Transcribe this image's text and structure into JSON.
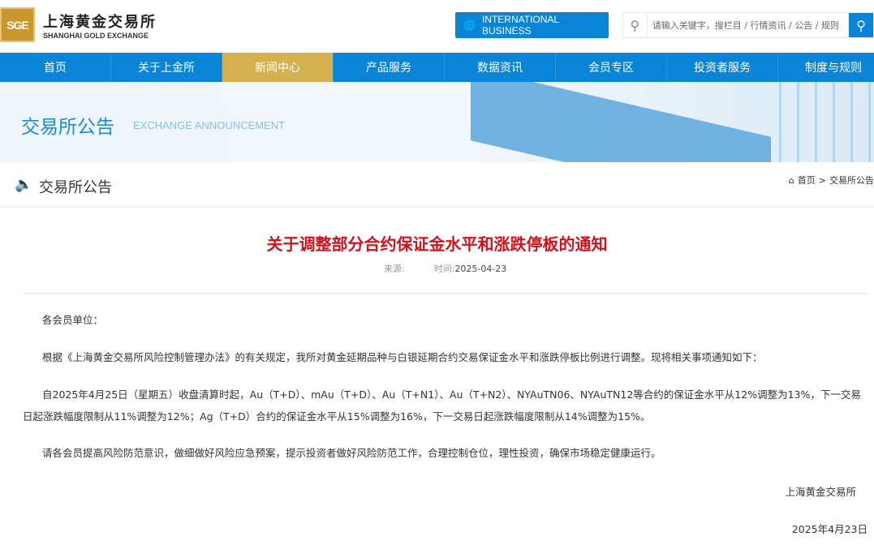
{
  "header": {
    "logo_mark": "SGE",
    "logo_cn": "上海黄金交易所",
    "logo_en": "SHANGHAI GOLD EXCHANGE",
    "intl_button": "INTERNATIONAL BUSINESS",
    "search_placeholder": "请输入关键字，搜栏目 / 行情资讯 / 公告 / 规则"
  },
  "nav": [
    "首页",
    "关于上金所",
    "新闻中心",
    "产品服务",
    "数据资讯",
    "会员专区",
    "投资者服务",
    "制度与规则"
  ],
  "banner": {
    "title_cn": "交易所公告",
    "title_en": "EXCHANGE ANNOUNCEMENT"
  },
  "section": {
    "title": "交易所公告",
    "breadcrumb": [
      "首页",
      "交易所公告"
    ]
  },
  "article": {
    "title": "关于调整部分合约保证金水平和涨跌停板的通知",
    "source_label": "来源:",
    "time_label": "时间:",
    "date": "2025-04-23",
    "salutation": "各会员单位：",
    "paragraphs": [
      "根据《上海黄金交易所风险控制管理办法》的有关规定，我所对黄金延期品种与白银延期合约交易保证金水平和涨跌停板比例进行调整。现将相关事项通知如下：",
      "自2025年4月25日（星期五）收盘清算时起，Au（T+D）、mAu（T+D）、Au（T+N1）、Au（T+N2）、NYAuTN06、NYAuTN12等合约的保证金水平从12%调整为13%，下一交易日起涨跌幅度限制从11%调整为12%；Ag（T+D）合约的保证金水平从15%调整为16%，下一交易日起涨跌幅度限制从14%调整为15%。",
      "请各会员提高风险防范意识，做细做好风险应急预案，提示投资者做好风险防范工作，合理控制仓位，理性投资，确保市场稳定健康运行。"
    ],
    "signature": "上海黄金交易所",
    "sign_date": "2025年4月23日"
  }
}
